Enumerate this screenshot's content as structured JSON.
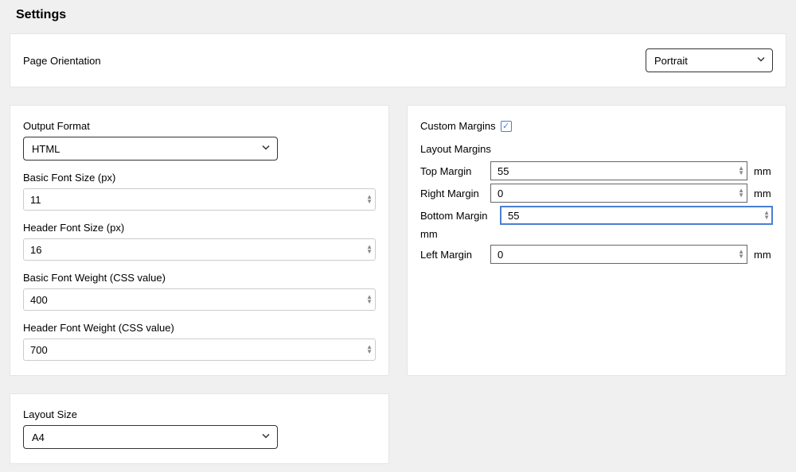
{
  "title": "Settings",
  "orientation": {
    "label": "Page Orientation",
    "value": "Portrait"
  },
  "output": {
    "format_label": "Output Format",
    "format_value": "HTML",
    "basic_font_size_label": "Basic Font Size (px)",
    "basic_font_size_value": "11",
    "header_font_size_label": "Header Font Size (px)",
    "header_font_size_value": "16",
    "basic_font_weight_label": "Basic Font Weight (CSS value)",
    "basic_font_weight_value": "400",
    "header_font_weight_label": "Header Font Weight (CSS value)",
    "header_font_weight_value": "700"
  },
  "margins": {
    "custom_label": "Custom Margins",
    "custom_checked": true,
    "section_label": "Layout Margins",
    "unit": "mm",
    "top_label": "Top Margin",
    "top_value": "55",
    "right_label": "Right Margin",
    "right_value": "0",
    "bottom_label": "Bottom Margin",
    "bottom_value": "55",
    "left_label": "Left Margin",
    "left_value": "0"
  },
  "layout": {
    "size_label": "Layout Size",
    "size_value": "A4"
  }
}
